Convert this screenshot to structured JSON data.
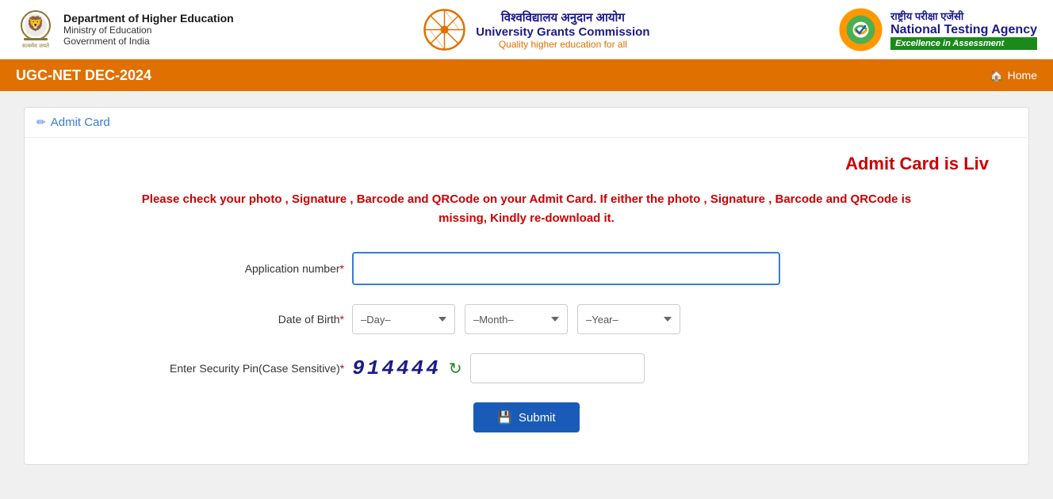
{
  "header": {
    "dept_title": "Department of Higher Education",
    "dept_ministry": "Ministry of Education",
    "dept_country": "Government of India",
    "ugc_title_hindi": "विश्वविद्यालय अनुदान आयोग",
    "ugc_title_en": "University Grants Commission",
    "ugc_tagline": "Quality higher education for all",
    "nta_title_hindi": "राष्ट्रीय परीक्षा एजेंसी",
    "nta_title_en": "National Testing Agency",
    "nta_badge": "Excellence in Assessment"
  },
  "navbar": {
    "title": "UGC-NET DEC-2024",
    "home_label": "Home",
    "home_icon": "🏠"
  },
  "card": {
    "header_icon": "✏",
    "header_title": "Admit Card"
  },
  "admit_live": {
    "text": "Admit Card is Li⁠v"
  },
  "warning": {
    "line1": "Please check your photo , Signature , Barcode and QRCode on your Admit Card. If either the photo , Signature , Barcode and QRCode is",
    "line2": "missing, Kindly re-download it."
  },
  "form": {
    "app_number_label": "Application number",
    "app_number_placeholder": "",
    "dob_label": "Date of Birth",
    "dob_day_default": "–Day–",
    "dob_month_default": "–Month–",
    "dob_year_default": "–Year–",
    "security_label": "Enter Security Pin(Case Sensitive)",
    "captcha_text": "914444",
    "security_placeholder": "",
    "submit_label": "Submit",
    "submit_icon": "💾",
    "required_marker": "*"
  }
}
